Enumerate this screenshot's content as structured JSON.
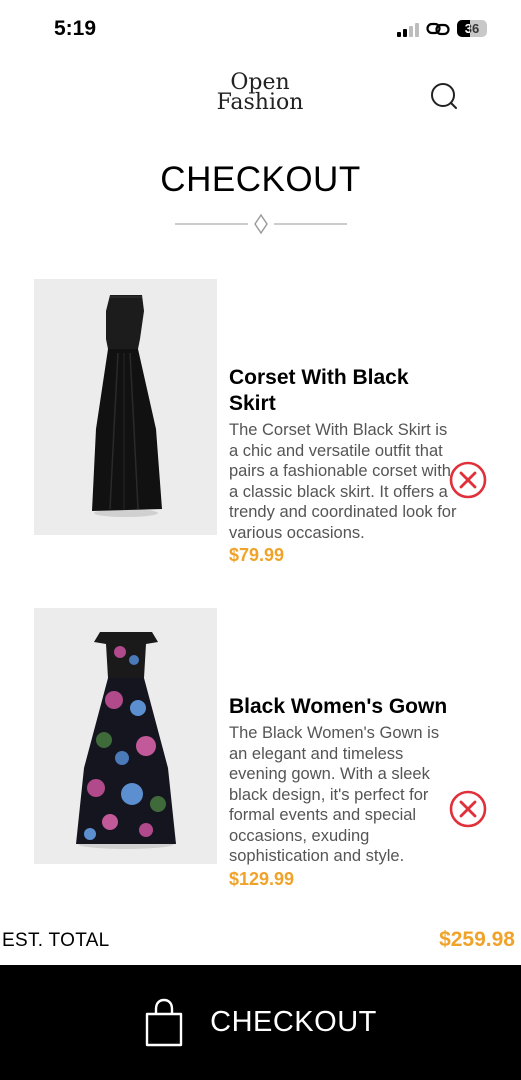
{
  "status_bar": {
    "time": "5:19",
    "battery": "36"
  },
  "header": {
    "logo_line1": "Open",
    "logo_line2": "Fashion"
  },
  "page": {
    "title": "CHECKOUT"
  },
  "cart": {
    "items": [
      {
        "name": "Corset With Black Skirt",
        "description": "The Corset With Black Skirt is a chic and versatile outfit that pairs a fashionable corset with a classic black skirt. It offers a trendy and coordinated look for various occasions.",
        "price": "$79.99"
      },
      {
        "name": "Black Women's Gown",
        "description": "The Black Women's Gown is an elegant and timeless evening gown. With a sleek black design, it's perfect for formal events and special occasions, exuding sophistication and style.",
        "price": "$129.99"
      }
    ]
  },
  "summary": {
    "total_label": "EST. TOTAL",
    "total_value": "$259.98"
  },
  "checkout_button": {
    "label": "CHECKOUT",
    "icon": "shopping-bag-icon"
  },
  "colors": {
    "accent": "#f0a32a",
    "remove": "#e0303a",
    "bar": "#000000"
  }
}
